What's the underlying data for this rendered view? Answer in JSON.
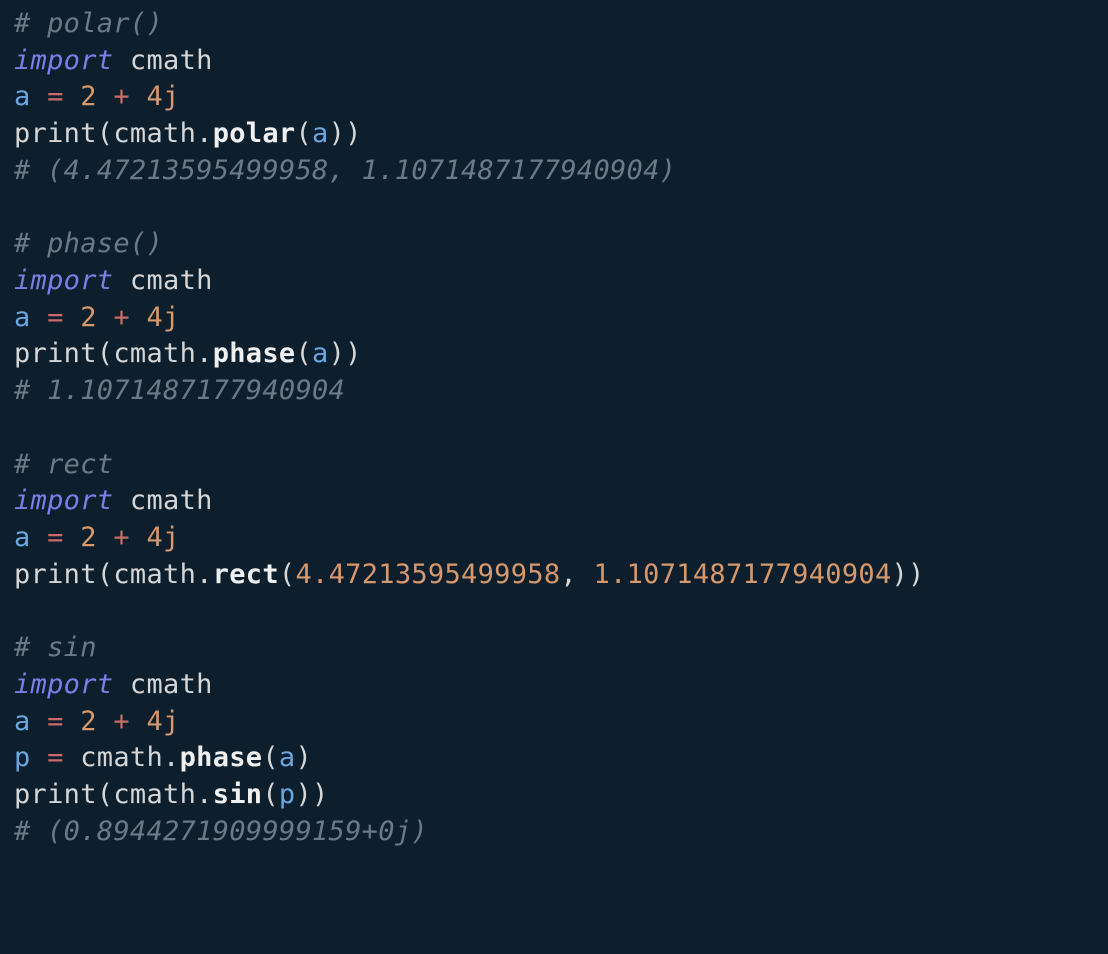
{
  "lines": {
    "l1": "# polar()",
    "l2a": "import",
    "l2b": " cmath",
    "l3a": "a",
    "l3b": " = ",
    "l3c": "2",
    "l3d": " + ",
    "l3e": "4j",
    "l4a": "print",
    "l4b": "(",
    "l4c": "cmath",
    "l4d": ".",
    "l4e": "polar",
    "l4f": "(",
    "l4g": "a",
    "l4h": "))",
    "l5": "# (4.47213595499958, 1.1071487177940904)",
    "l6": "",
    "l7": "# phase()",
    "l8a": "import",
    "l8b": " cmath",
    "l9a": "a",
    "l9b": " = ",
    "l9c": "2",
    "l9d": " + ",
    "l9e": "4j",
    "l10a": "print",
    "l10b": "(",
    "l10c": "cmath",
    "l10d": ".",
    "l10e": "phase",
    "l10f": "(",
    "l10g": "a",
    "l10h": "))",
    "l11": "# 1.1071487177940904",
    "l12": "",
    "l13": "# rect",
    "l14a": "import",
    "l14b": " cmath",
    "l15a": "a",
    "l15b": " = ",
    "l15c": "2",
    "l15d": " + ",
    "l15e": "4j",
    "l16a": "print",
    "l16b": "(",
    "l16c": "cmath",
    "l16d": ".",
    "l16e": "rect",
    "l16f": "(",
    "l16g": "4.47213595499958",
    "l16h": ", ",
    "l16i": "1.1071487177940904",
    "l16j": "))",
    "l17": "",
    "l18": "# sin",
    "l19a": "import",
    "l19b": " cmath",
    "l20a": "a",
    "l20b": " = ",
    "l20c": "2",
    "l20d": " + ",
    "l20e": "4j",
    "l21a": "p",
    "l21b": " = ",
    "l21c": "cmath",
    "l21d": ".",
    "l21e": "phase",
    "l21f": "(",
    "l21g": "a",
    "l21h": ")",
    "l22a": "print",
    "l22b": "(",
    "l22c": "cmath",
    "l22d": ".",
    "l22e": "sin",
    "l22f": "(",
    "l22g": "p",
    "l22h": "))",
    "l23": "# (0.8944271909999159+0j)"
  }
}
